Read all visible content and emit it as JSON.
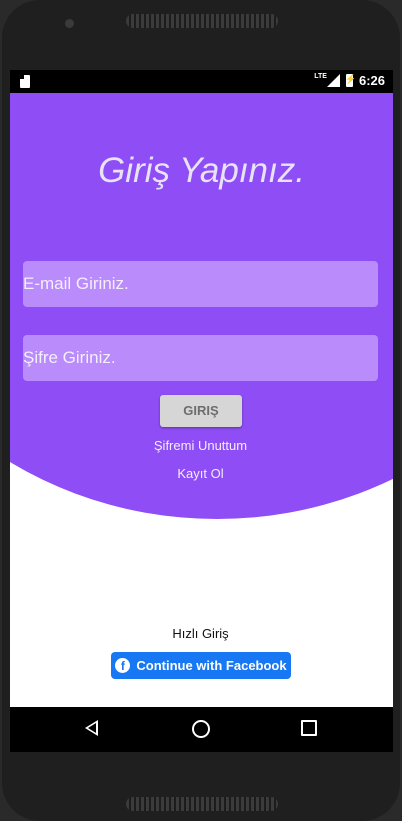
{
  "status_bar": {
    "network": "LTE",
    "time": "6:26"
  },
  "login": {
    "title": "Giriş Yapınız.",
    "email_placeholder": "E-mail Giriniz.",
    "password_placeholder": "Şifre Giriniz.",
    "login_button": "GIRIŞ",
    "forgot_password": "Şifremi Unuttum",
    "register": "Kayıt Ol"
  },
  "quick_login": {
    "label": "Hızlı Giriş",
    "facebook_button": "Continue with Facebook"
  },
  "colors": {
    "primary": "#9250f7",
    "field_bg": "#b98bfb",
    "facebook": "#1877f2"
  },
  "icons": [
    "sim-card-icon",
    "signal-icon",
    "battery-icon",
    "facebook-icon",
    "back-icon",
    "home-icon",
    "recents-icon"
  ]
}
